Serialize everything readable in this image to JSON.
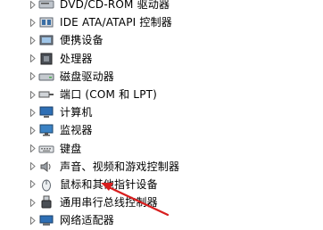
{
  "device_tree": {
    "items": [
      {
        "label": "DVD/CD-ROM 驱动器",
        "icon": "dvd-drive-icon"
      },
      {
        "label": "IDE ATA/ATAPI 控制器",
        "icon": "ide-controller-icon"
      },
      {
        "label": "便携设备",
        "icon": "portable-device-icon"
      },
      {
        "label": "处理器",
        "icon": "processor-icon"
      },
      {
        "label": "磁盘驱动器",
        "icon": "disk-drive-icon"
      },
      {
        "label": "端口 (COM 和 LPT)",
        "icon": "port-icon"
      },
      {
        "label": "计算机",
        "icon": "computer-icon"
      },
      {
        "label": "监视器",
        "icon": "monitor-icon"
      },
      {
        "label": "键盘",
        "icon": "keyboard-icon"
      },
      {
        "label": "声音、视频和游戏控制器",
        "icon": "sound-icon"
      },
      {
        "label": "鼠标和其他指针设备",
        "icon": "mouse-icon"
      },
      {
        "label": "通用串行总线控制器",
        "icon": "usb-icon"
      },
      {
        "label": "网络适配器",
        "icon": "network-adapter-icon"
      }
    ]
  },
  "annotation": {
    "arrow_color": "#d81e1e",
    "points_to": "鼠标和其他指针设备"
  }
}
